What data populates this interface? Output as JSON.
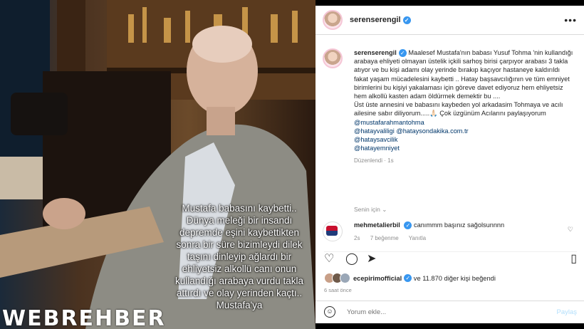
{
  "post": {
    "username": "serenserengil",
    "caption_user": "serenserengil",
    "caption_lines": [
      "Maalesef Mustafa'nın babası Yusuf Tohma 'nin kullandığı arabaya ehliyeti olmayan üstelik içkili sarhoş birisi çarpıyor arabası 3 takla atıyor ve bu kişi adamı olay yerinde bırakıp kaçıyor hastaneye kaldırıldı fakat yaşam mücadelesini kaybetti .. Hatay başsavcılığının ve tüm emniyet birimlerini bu kişiyi yakalaması için göreve davet ediyoruz hem ehliyetsiz hem alkollü kasten adam öldürmek demektir bu ....",
      "Üst üste annesini ve babasını kaybeden yol arkadasim Tohmaya ve acılı ailesine sabır diliyorum.....🙏🏻 Çok üzgünüm Acılarını paylaşıyorum"
    ],
    "tags": [
      "@mustafarahmantohma",
      "@hatayvaliligi @hataysondakika.com.tr",
      "@hataysavcilik",
      "@hatayemniyet"
    ],
    "edited": "Düzenlendi · 1s",
    "for_you": "Senin için",
    "comment": {
      "user": "mehmetalierbil",
      "text": "canımmm başınız sağolsunnnn",
      "time": "2s",
      "likes": "7 beğenme",
      "reply": "Yanıtla"
    },
    "likes_user": "ecepirimofficial",
    "likes_rest": "ve 11.870 diğer kişi beğendi",
    "time_ago": "6 saat önce",
    "comment_placeholder": "Yorum ekle...",
    "share_label": "Paylaş"
  },
  "overlay_text": "Mustafa babasını kaybetti.. Dünya meleği bir insandı depremde eşini kaybettikten sonra bir süre bizimleydi dilek taşını dinleyip ağlardı bir ehliyetsiz alkollü canı onun kullandığı arabaya vurdu takla attırdı ve olay yerinden kaçtı.. Mustafa'ya",
  "watermark": "WEBREHBER",
  "colors": {
    "link": "#00376b",
    "verified": "#3897f0",
    "meta": "#8e8e8e"
  }
}
